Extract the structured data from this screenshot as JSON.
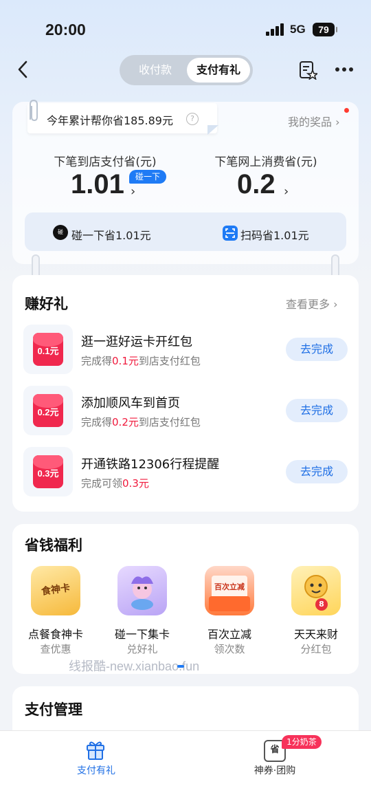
{
  "status_bar": {
    "time": "20:00",
    "network": "5G",
    "battery": "79"
  },
  "nav": {
    "segments": [
      "收付款",
      "支付有礼"
    ],
    "active_segment": "支付有礼"
  },
  "savings": {
    "summary": "今年累计帮你省185.89元",
    "help": "?",
    "my_prizes": "我的奖品 ›",
    "next_store_label": "下笔到店支付省(元)",
    "next_store_value": "1.01",
    "tap_badge": "碰一下",
    "next_online_label": "下笔网上消费省(元)",
    "next_online_value": "0.2",
    "arrow": "›",
    "tap_save": "碰一下省1.01元",
    "scan_save": "扫码省1.01元",
    "tap_icon_text": "碰"
  },
  "earn": {
    "title": "赚好礼",
    "see_more": "查看更多 ›",
    "tasks": [
      {
        "amount": "0.1元",
        "title": "逛一逛好运卡开红包",
        "sub_pre": "完成得",
        "sub_red": "0.1元",
        "sub_post": "到店支付红包",
        "button": "去完成"
      },
      {
        "amount": "0.2元",
        "title": "添加顺风车到首页",
        "sub_pre": "完成得",
        "sub_red": "0.2元",
        "sub_post": "到店支付红包",
        "button": "去完成"
      },
      {
        "amount": "0.3元",
        "title": "开通铁路12306行程提醒",
        "sub_pre": "完成可领",
        "sub_red": "0.3元",
        "sub_post": "",
        "button": "去完成"
      }
    ]
  },
  "benefits": {
    "title": "省钱福利",
    "items": [
      {
        "name": "点餐食神卡",
        "sub": "查优惠",
        "icon_text": "食神卡"
      },
      {
        "name": "碰一下集卡",
        "sub": "兑好礼",
        "icon_text": ""
      },
      {
        "name": "百次立减",
        "sub": "领次数",
        "icon_text": "百次立减"
      },
      {
        "name": "天天来财",
        "sub": "分红包",
        "icon_text": "8"
      }
    ]
  },
  "watermark": "线报酷-new.xianbao.fun",
  "pay_mgmt": {
    "title": "支付管理"
  },
  "tabbar": {
    "tab1": "支付有礼",
    "tab2": "神券·团购",
    "tab2_icon": "省",
    "tab2_badge": "1分奶茶"
  },
  "colors": {
    "accent": "#1f6fe5",
    "red": "#f0193c",
    "envelope": "#f0284e"
  }
}
